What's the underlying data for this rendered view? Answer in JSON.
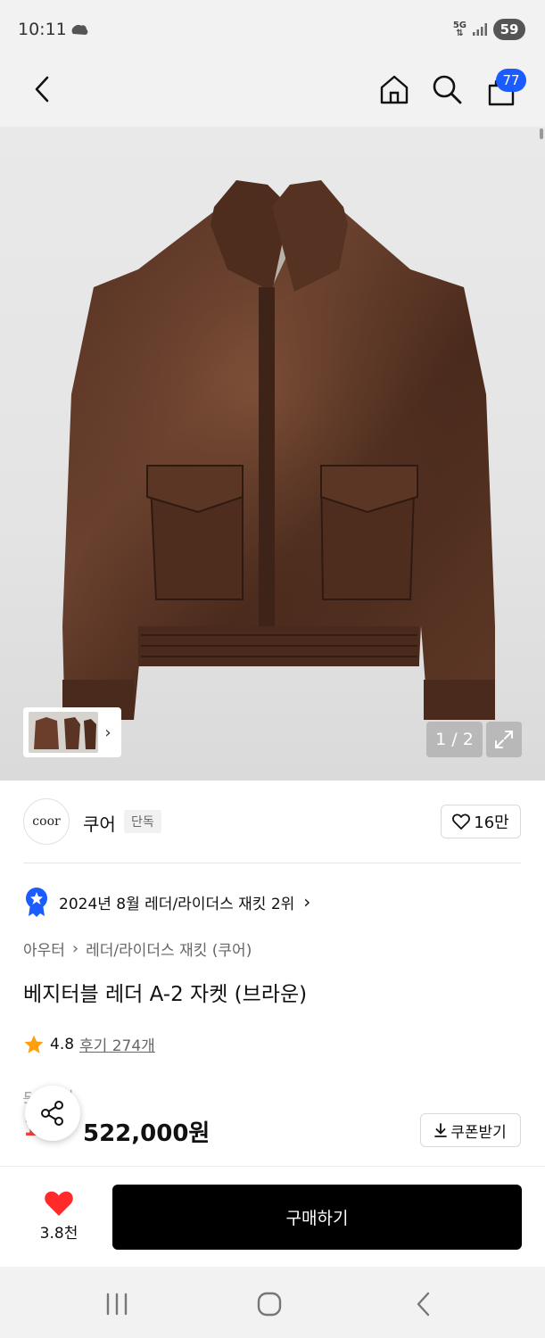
{
  "status_bar": {
    "time": "10:11",
    "network": "5G",
    "battery": "59"
  },
  "app_bar": {
    "cart_count": "77"
  },
  "gallery": {
    "page_counter": "1 / 2"
  },
  "brand": {
    "logo_text": "coor",
    "name": "쿠어",
    "tag": "단독",
    "likes": "16만"
  },
  "ranking": {
    "text": "2024년 8월 레더/라이더스 재킷 2위"
  },
  "breadcrumb": {
    "category": "아우터",
    "subcategory": "레더/라이더스 재킷 (쿠어)"
  },
  "product": {
    "title": "베지터블 레더 A-2 자켓 (브라운)",
    "rating": "4.8",
    "reviews": "후기 274개",
    "original_price": "5  90원",
    "discount": "1",
    "sale_price": "522,000원"
  },
  "coupon": {
    "label": "쿠폰받기"
  },
  "bottom_bar": {
    "wish_count": "3.8천",
    "buy_label": "구매하기"
  },
  "colors": {
    "accent_blue": "#1a5cff",
    "heart_red": "#ff2b2b",
    "star_orange": "#ff9e0f",
    "buy_button": "#000000"
  }
}
